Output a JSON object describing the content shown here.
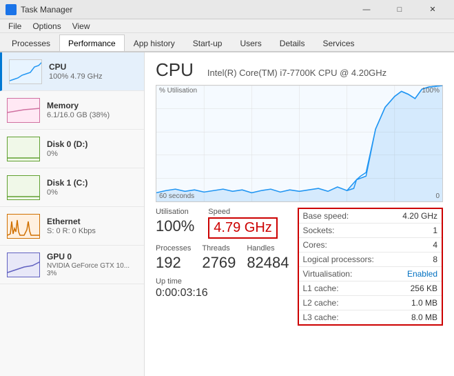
{
  "titleBar": {
    "title": "Task Manager",
    "minimizeBtn": "—",
    "maximizeBtn": "□",
    "closeBtn": "✕"
  },
  "menuBar": {
    "items": [
      "File",
      "Options",
      "View"
    ]
  },
  "tabs": [
    {
      "label": "Processes",
      "active": false
    },
    {
      "label": "Performance",
      "active": true
    },
    {
      "label": "App history",
      "active": false
    },
    {
      "label": "Start-up",
      "active": false
    },
    {
      "label": "Users",
      "active": false
    },
    {
      "label": "Details",
      "active": false
    },
    {
      "label": "Services",
      "active": false
    }
  ],
  "sidebar": {
    "items": [
      {
        "name": "CPU",
        "stat": "100% 4.79 GHz",
        "type": "cpu",
        "active": true
      },
      {
        "name": "Memory",
        "stat": "6.1/16.0 GB (38%)",
        "type": "memory",
        "active": false
      },
      {
        "name": "Disk 0 (D:)",
        "stat": "0%",
        "type": "disk0",
        "active": false
      },
      {
        "name": "Disk 1 (C:)",
        "stat": "0%",
        "type": "disk1",
        "active": false
      },
      {
        "name": "Ethernet",
        "stat": "S: 0 R: 0 Kbps",
        "type": "ethernet",
        "active": false
      },
      {
        "name": "GPU 0",
        "stat": "NVIDIA GeForce GTX 10...\n3%",
        "type": "gpu",
        "active": false
      }
    ]
  },
  "chart": {
    "yLabel": "% Utilisation",
    "yMax": "100%",
    "xLeft": "60 seconds",
    "xRight": "0"
  },
  "cpuTitle": "CPU",
  "cpuModel": "Intel(R) Core(TM) i7-7700K CPU @ 4.20GHz",
  "stats": {
    "utilisationLabel": "Utilisation",
    "utilisationValue": "100%",
    "speedLabel": "Speed",
    "speedValue": "4.79 GHz",
    "processesLabel": "Processes",
    "processesValue": "192",
    "threadsLabel": "Threads",
    "threadsValue": "2769",
    "handlesLabel": "Handles",
    "handlesValue": "82484",
    "uptimeLabel": "Up time",
    "uptimeValue": "0:00:03:16"
  },
  "infoTable": {
    "baseSpeedLabel": "Base speed:",
    "baseSpeedValue": "4.20 GHz",
    "socketsLabel": "Sockets:",
    "socketsValue": "1",
    "coresLabel": "Cores:",
    "coresValue": "4",
    "logicalLabel": "Logical processors:",
    "logicalValue": "8",
    "virtualisationLabel": "Virtualisation:",
    "virtualisationValue": "Enabled",
    "l1Label": "L1 cache:",
    "l1Value": "256 KB",
    "l2Label": "L2 cache:",
    "l2Value": "1.0 MB",
    "l3Label": "L3 cache:",
    "l3Value": "8.0 MB"
  },
  "colors": {
    "accent": "#0078d4",
    "highlight": "#cc0000",
    "chartLine": "#2196F3",
    "cpuBorder": "#2196F3"
  }
}
